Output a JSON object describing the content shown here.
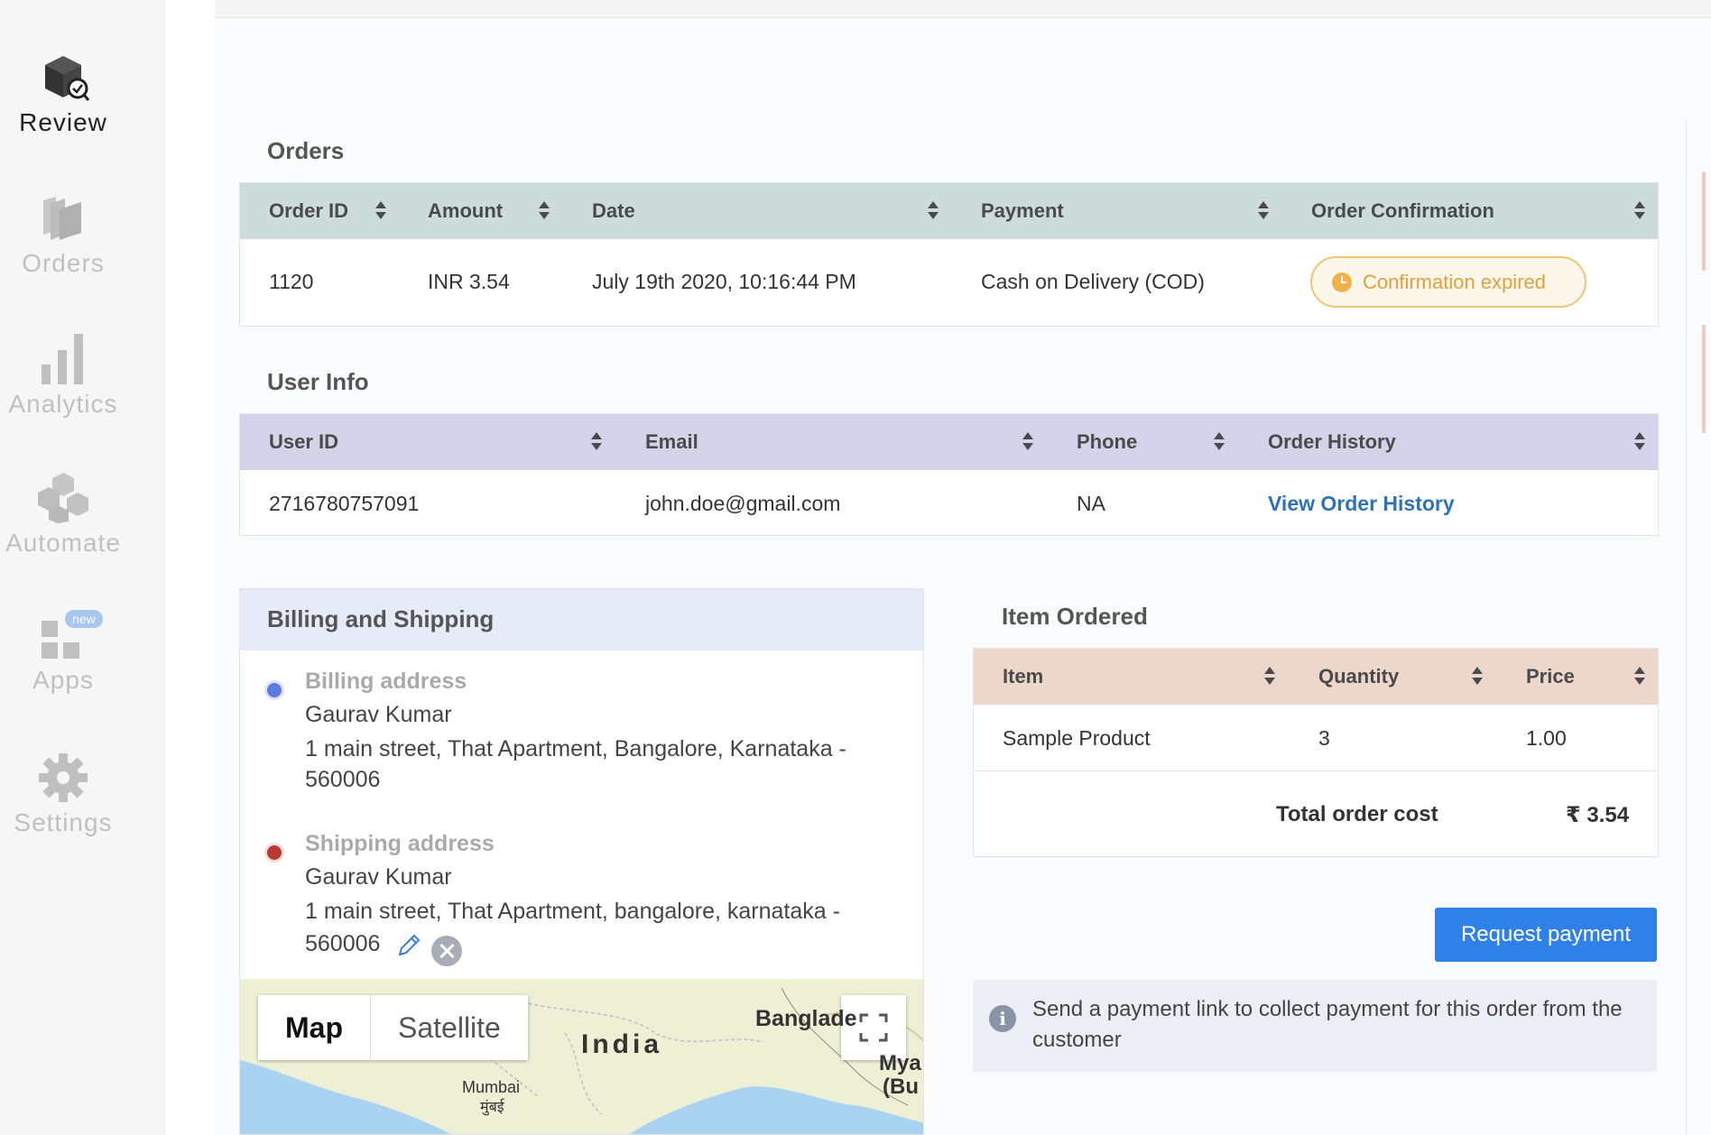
{
  "sidebar": {
    "items": [
      {
        "label": "Review",
        "icon": "box-review-icon",
        "active": true
      },
      {
        "label": "Orders",
        "icon": "stacked-pages-icon"
      },
      {
        "label": "Analytics",
        "icon": "bar-chart-icon"
      },
      {
        "label": "Automate",
        "icon": "cubes-icon"
      },
      {
        "label": "Apps",
        "icon": "grid-apps-icon",
        "badge": "new"
      },
      {
        "label": "Settings",
        "icon": "gear-icon"
      }
    ]
  },
  "orders": {
    "title": "Orders",
    "header_color": "#cddcdb",
    "columns": [
      "Order ID",
      "Amount",
      "Date",
      "Payment",
      "Order Confirmation"
    ],
    "row": {
      "order_id": "1120",
      "amount": "INR 3.54",
      "date": "July 19th 2020, 10:16:44 PM",
      "payment": "Cash on Delivery (COD)",
      "confirmation": "Confirmation expired"
    }
  },
  "user_info": {
    "title": "User Info",
    "header_color": "#d3d3ea",
    "columns": [
      "User ID",
      "Email",
      "Phone",
      "Order History"
    ],
    "row": {
      "user_id": "2716780757091",
      "email": "john.doe@gmail.com",
      "phone": "NA",
      "order_history": "View Order History"
    }
  },
  "billing": {
    "title": "Billing and Shipping",
    "billing_label": "Billing address",
    "billing_name": "Gaurav Kumar",
    "billing_address": "1 main street, That Apartment, Bangalore, Karnataka - 560006",
    "shipping_label": "Shipping address",
    "shipping_name": "Gaurav Kumar",
    "shipping_address_line1": "1 main street, That Apartment, bangalore, karnataka -",
    "shipping_address_line2": "560006",
    "billing_dot_color": "#5b7be0",
    "shipping_dot_color": "#b83a32"
  },
  "map": {
    "map_btn": "Map",
    "satellite_btn": "Satellite",
    "labels": {
      "india": "India",
      "bangladesh": "Banglade",
      "myanmar1": "Mya",
      "myanmar2": "(Bu",
      "mumbai": "Mumbai",
      "mumbai_hi": "मुंबई"
    }
  },
  "items": {
    "title": "Item Ordered",
    "header_color": "#ecd7ca",
    "columns": [
      "Item",
      "Quantity",
      "Price"
    ],
    "rows": [
      {
        "item": "Sample Product",
        "quantity": "3",
        "price": "1.00"
      }
    ],
    "total_label": "Total order cost",
    "total_value": "₹ 3.54"
  },
  "actions": {
    "request_payment": "Request payment",
    "info_text": "Send a payment link to collect payment for this order from the customer"
  }
}
